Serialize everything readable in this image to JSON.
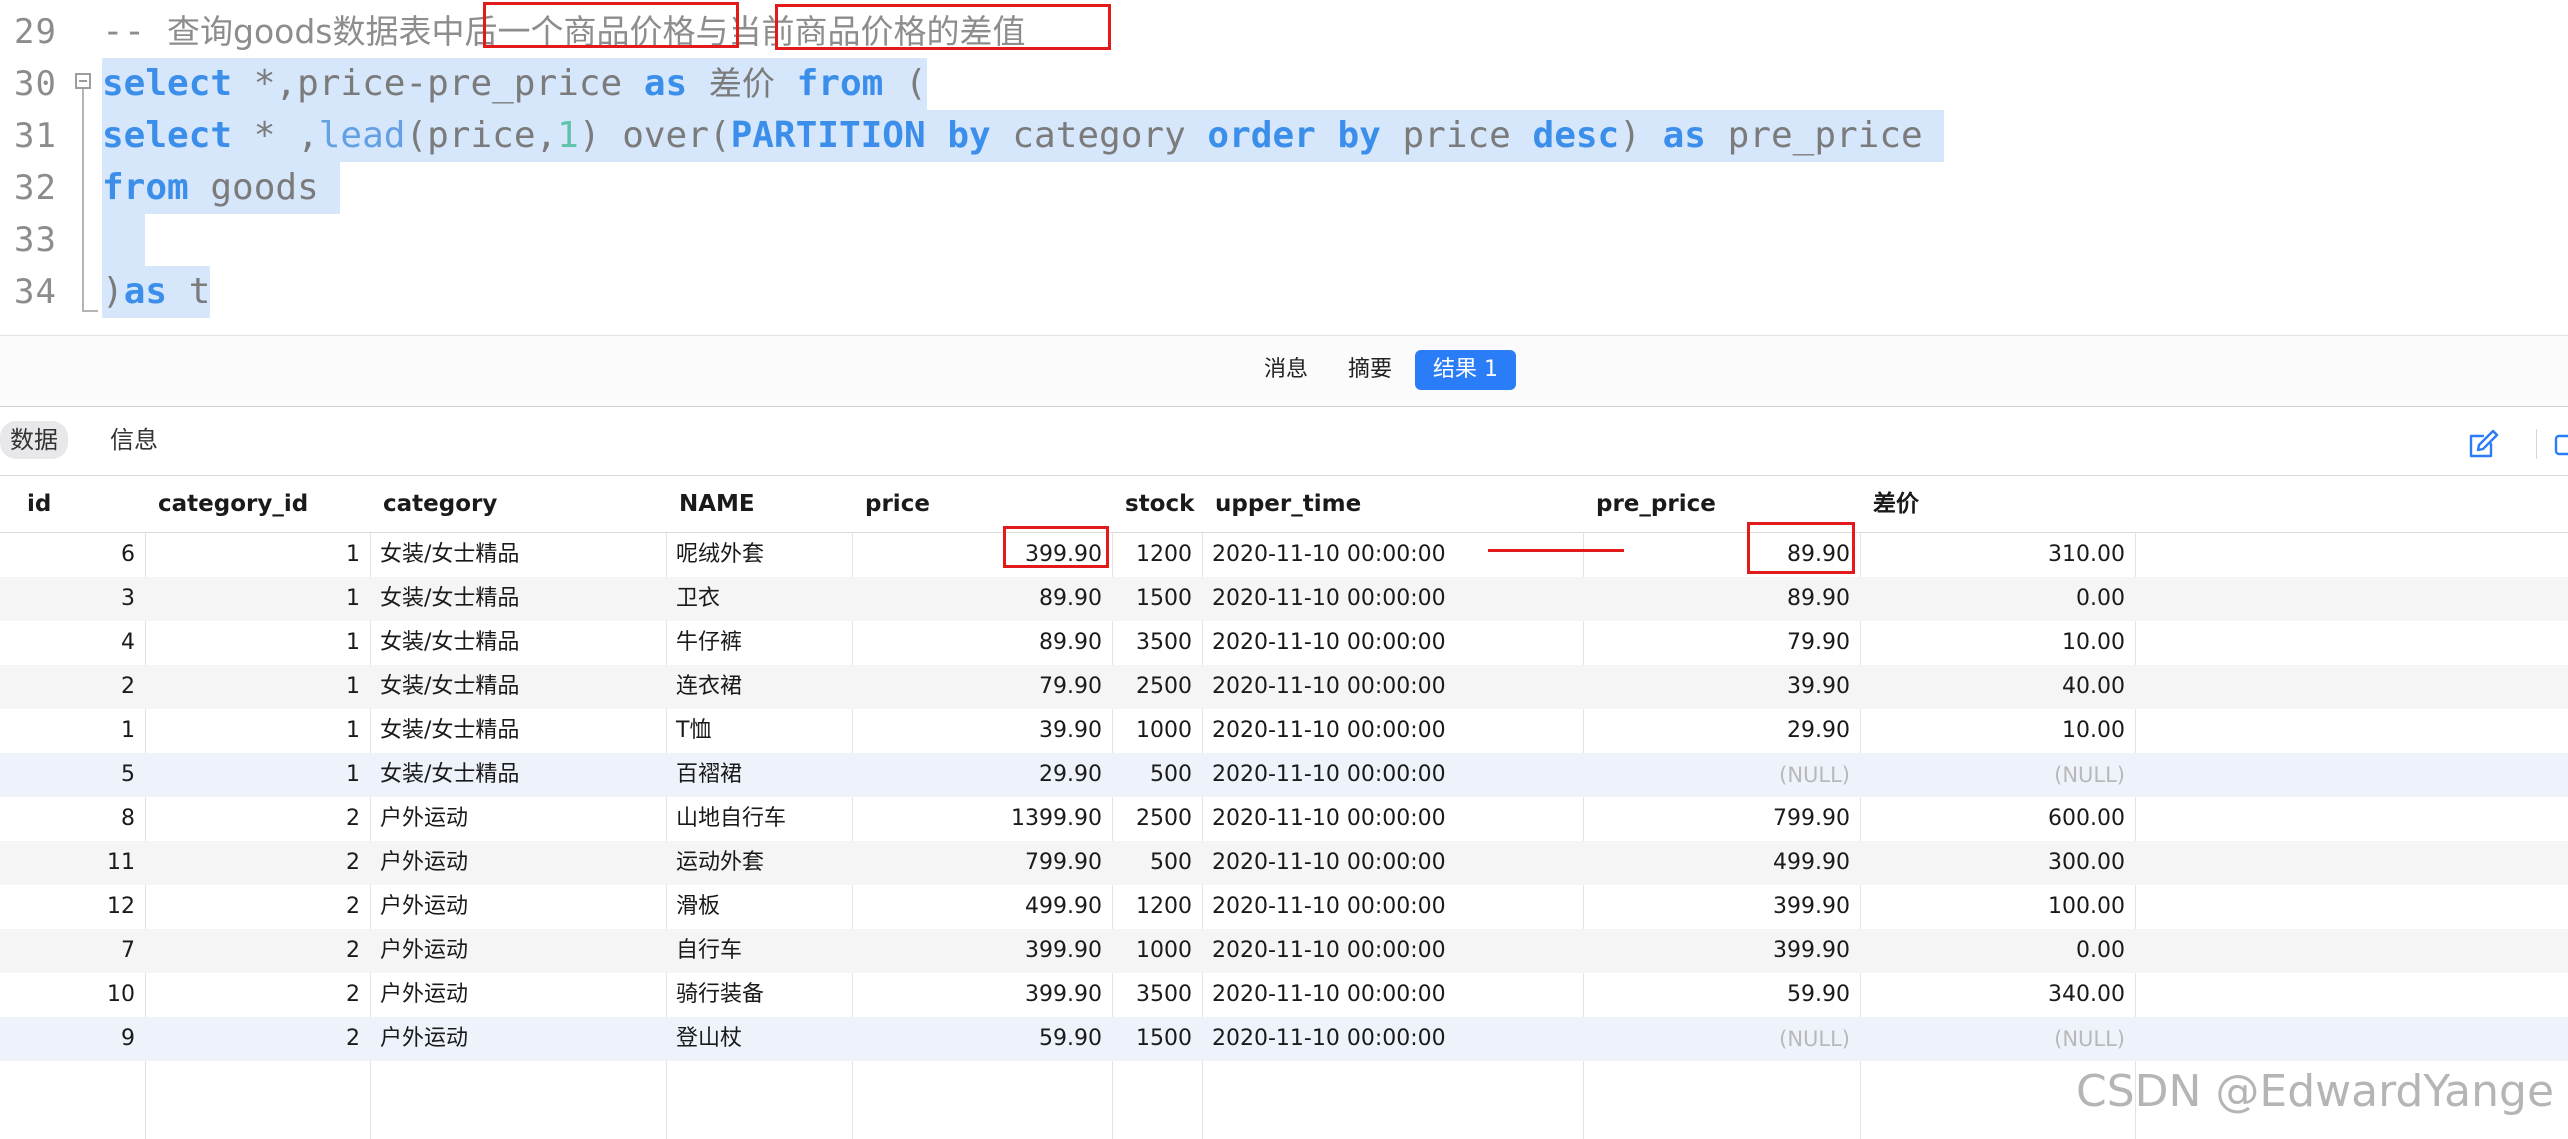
{
  "editor": {
    "lines": [
      {
        "num": "29",
        "tokens": [
          {
            "t": "-- ",
            "c": "tk-comment"
          },
          {
            "t": "查询goods数据表中后一个商品价格与当前商品价格的差值",
            "c": "tk-comment tk-cjk"
          }
        ]
      },
      {
        "num": "30",
        "tokens": [
          {
            "t": "select",
            "c": "tk-kw"
          },
          {
            "t": " *,price-pre_price ",
            "c": "tk-plain"
          },
          {
            "t": "as",
            "c": "tk-kw"
          },
          {
            "t": " ",
            "c": "tk-plain"
          },
          {
            "t": "差价",
            "c": "tk-cjk"
          },
          {
            "t": " ",
            "c": "tk-plain"
          },
          {
            "t": "from",
            "c": "tk-kw"
          },
          {
            "t": " (",
            "c": "tk-plain"
          }
        ]
      },
      {
        "num": "31",
        "tokens": [
          {
            "t": "select",
            "c": "tk-kw"
          },
          {
            "t": " * ,",
            "c": "tk-plain"
          },
          {
            "t": "lead",
            "c": "tk-fn"
          },
          {
            "t": "(price,",
            "c": "tk-plain"
          },
          {
            "t": "1",
            "c": "tk-num"
          },
          {
            "t": ") over(",
            "c": "tk-plain"
          },
          {
            "t": "PARTITION by",
            "c": "tk-kw"
          },
          {
            "t": " category ",
            "c": "tk-plain"
          },
          {
            "t": "order by",
            "c": "tk-kw"
          },
          {
            "t": " price ",
            "c": "tk-plain"
          },
          {
            "t": "desc",
            "c": "tk-kw"
          },
          {
            "t": ") ",
            "c": "tk-plain"
          },
          {
            "t": "as",
            "c": "tk-kw"
          },
          {
            "t": " pre_price ",
            "c": "tk-plain"
          }
        ]
      },
      {
        "num": "32",
        "tokens": [
          {
            "t": "from",
            "c": "tk-kw"
          },
          {
            "t": " goods ",
            "c": "tk-plain"
          }
        ]
      },
      {
        "num": "33",
        "tokens": [
          {
            "t": "  ",
            "c": "tk-plain"
          }
        ]
      },
      {
        "num": "34",
        "tokens": [
          {
            "t": ")",
            "c": "tk-plain"
          },
          {
            "t": "as",
            "c": "tk-kw"
          },
          {
            "t": " t",
            "c": "tk-plain"
          }
        ]
      }
    ]
  },
  "result_tabs": [
    "消息",
    "摘要",
    "结果 1"
  ],
  "active_result_tab": "结果 1",
  "sub_tabs": [
    "数据",
    "信息"
  ],
  "active_sub_tab": "数据",
  "columns": [
    "id",
    "category_id",
    "category",
    "NAME",
    "price",
    "stock",
    "upper_time",
    "pre_price",
    "差价"
  ],
  "rows": [
    [
      "6",
      "1",
      "女装/女士精品",
      "呢绒外套",
      "399.90",
      "1200",
      "2020-11-10 00:00:00",
      "89.90",
      "310.00"
    ],
    [
      "3",
      "1",
      "女装/女士精品",
      "卫衣",
      "89.90",
      "1500",
      "2020-11-10 00:00:00",
      "89.90",
      "0.00"
    ],
    [
      "4",
      "1",
      "女装/女士精品",
      "牛仔裤",
      "89.90",
      "3500",
      "2020-11-10 00:00:00",
      "79.90",
      "10.00"
    ],
    [
      "2",
      "1",
      "女装/女士精品",
      "连衣裙",
      "79.90",
      "2500",
      "2020-11-10 00:00:00",
      "39.90",
      "40.00"
    ],
    [
      "1",
      "1",
      "女装/女士精品",
      "T恤",
      "39.90",
      "1000",
      "2020-11-10 00:00:00",
      "29.90",
      "10.00"
    ],
    [
      "5",
      "1",
      "女装/女士精品",
      "百褶裙",
      "29.90",
      "500",
      "2020-11-10 00:00:00",
      "(NULL)",
      "(NULL)"
    ],
    [
      "8",
      "2",
      "户外运动",
      "山地自行车",
      "1399.90",
      "2500",
      "2020-11-10 00:00:00",
      "799.90",
      "600.00"
    ],
    [
      "11",
      "2",
      "户外运动",
      "运动外套",
      "799.90",
      "500",
      "2020-11-10 00:00:00",
      "499.90",
      "300.00"
    ],
    [
      "12",
      "2",
      "户外运动",
      "滑板",
      "499.90",
      "1200",
      "2020-11-10 00:00:00",
      "399.90",
      "100.00"
    ],
    [
      "7",
      "2",
      "户外运动",
      "自行车",
      "399.90",
      "1000",
      "2020-11-10 00:00:00",
      "399.90",
      "0.00"
    ],
    [
      "10",
      "2",
      "户外运动",
      "骑行装备",
      "399.90",
      "3500",
      "2020-11-10 00:00:00",
      "59.90",
      "340.00"
    ],
    [
      "9",
      "2",
      "户外运动",
      "登山杖",
      "59.90",
      "1500",
      "2020-11-10 00:00:00",
      "(NULL)",
      "(NULL)"
    ]
  ],
  "watermark": "CSDN @EdwardYange",
  "colors": {
    "keyword": "#3b8eea",
    "selection": "#d6e6fb",
    "active_tab": "#2a7cf7",
    "annotation": "#e31a1a"
  }
}
